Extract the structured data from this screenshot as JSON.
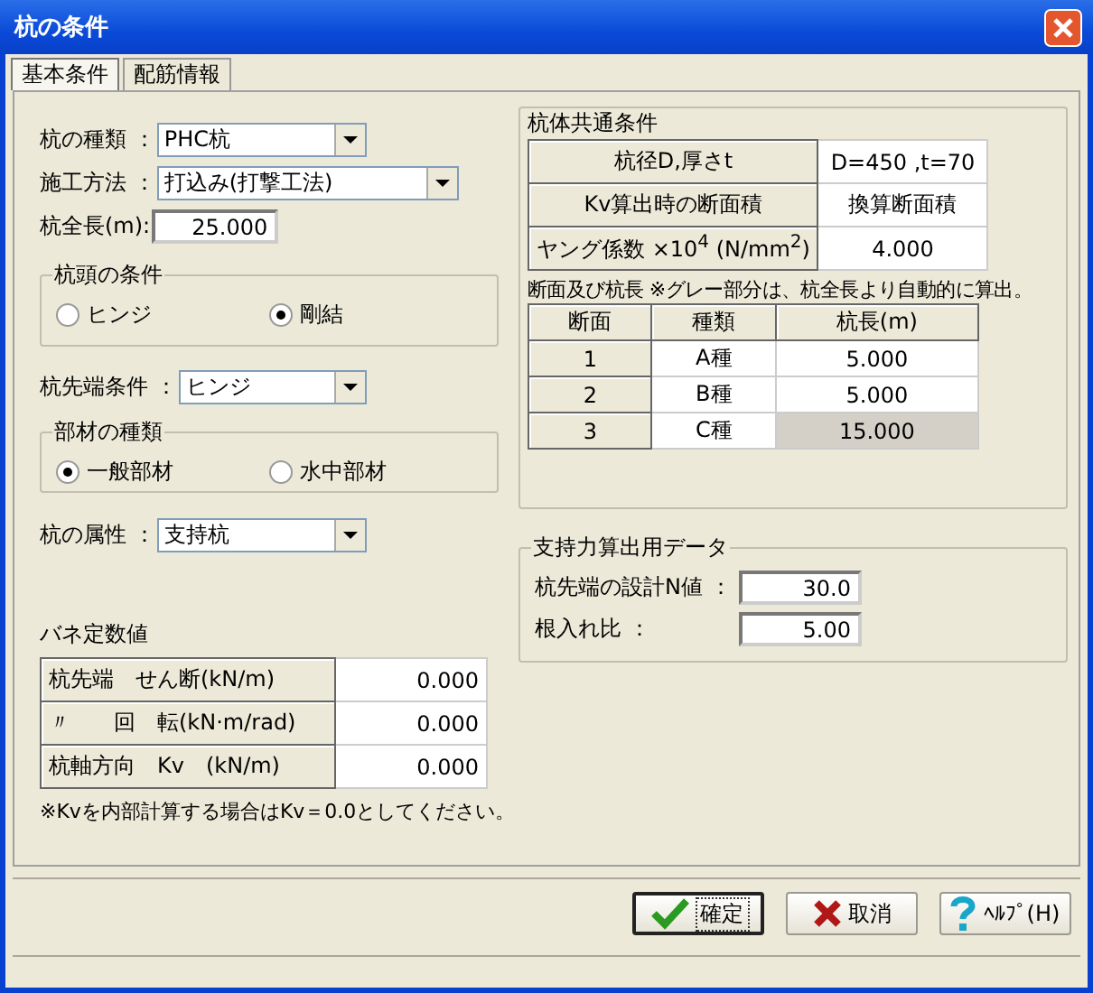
{
  "window": {
    "title": "杭の条件"
  },
  "tabs": [
    {
      "label": "基本条件",
      "selected": true
    },
    {
      "label": "配筋情報",
      "selected": false
    }
  ],
  "pile_type": {
    "label": "杭の種類 ：",
    "value": "PHC杭"
  },
  "construction_method": {
    "label": "施工方法 ：",
    "value": "打込み(打撃工法)"
  },
  "pile_length": {
    "label": "杭全長(m):",
    "value": "25.000"
  },
  "head_condition": {
    "title": "杭頭の条件",
    "options": [
      {
        "label": "ヒンジ",
        "selected": false
      },
      {
        "label": "剛結",
        "selected": true
      }
    ]
  },
  "tip_condition": {
    "label": "杭先端条件 ：",
    "value": "ヒンジ"
  },
  "member_type": {
    "title": "部材の種類",
    "options": [
      {
        "label": "一般部材",
        "selected": true
      },
      {
        "label": "水中部材",
        "selected": false
      }
    ]
  },
  "pile_attribute": {
    "label": "杭の属性 ：",
    "value": "支持杭"
  },
  "spring": {
    "title": "バネ定数値",
    "rows": [
      {
        "label": "杭先端　せん断(kN/m)",
        "value": "0.000"
      },
      {
        "label": "〃　　回　転(kN·m/rad)",
        "value": "0.000"
      },
      {
        "label": "杭軸方向　Kv　(kN/m)",
        "value": "0.000"
      }
    ],
    "note": "※Kvを内部計算する場合はKv＝0.0としてください。"
  },
  "body_common": {
    "title": "杭体共通条件",
    "rows": [
      {
        "label": "杭径D,厚さt",
        "value": "D=450 ,t=70"
      },
      {
        "label": "Kv算出時の断面積",
        "value": "換算断面積"
      },
      {
        "label": "ヤング係数 ×10$^{4}$ (N/mm$^{2}$)",
        "value": "4.000"
      }
    ]
  },
  "sections": {
    "caption": "断面及び杭長 ※グレー部分は、杭全長より自動的に算出。",
    "columns": [
      "断面",
      "種類",
      "杭長(m)"
    ],
    "rows": [
      {
        "no": "1",
        "type": "A種",
        "length": "5.000",
        "computed": false
      },
      {
        "no": "2",
        "type": "B種",
        "length": "5.000",
        "computed": false
      },
      {
        "no": "3",
        "type": "C種",
        "length": "15.000",
        "computed": true
      }
    ]
  },
  "bearing": {
    "title": "支持力算出用データ",
    "fields": [
      {
        "label": "杭先端の設計N値 ：",
        "value": "30.0"
      },
      {
        "label": "根入れ比 ：",
        "value": "5.00"
      }
    ]
  },
  "buttons": [
    {
      "kind": "ok",
      "label": "確定",
      "focused": true
    },
    {
      "kind": "cancel",
      "label": "取消",
      "focused": false
    },
    {
      "kind": "help",
      "label": "ﾍﾙﾌﾟ(H)",
      "focused": false
    }
  ]
}
